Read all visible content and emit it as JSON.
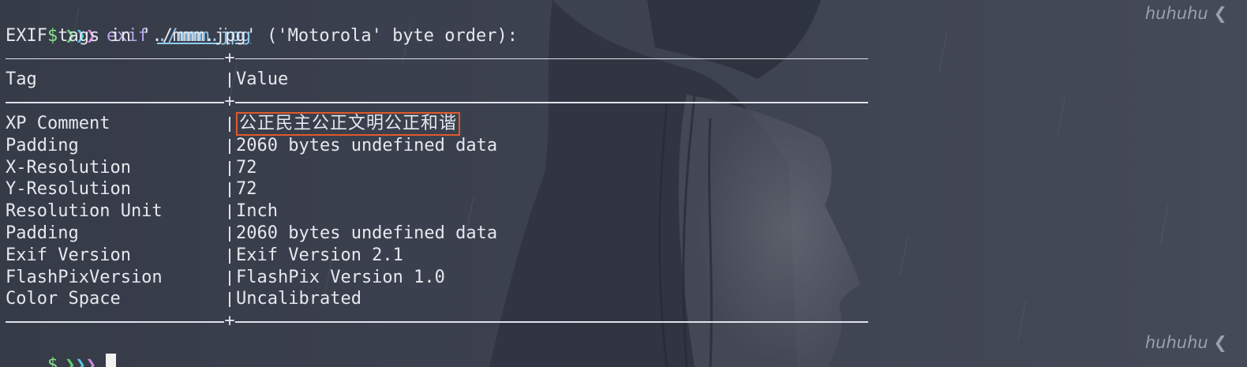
{
  "prompt": {
    "dollar": "$",
    "arrow": "❯",
    "command": "exif",
    "argument": "./mmm.jpg",
    "right_label": "huhuhu ❮"
  },
  "output": {
    "header_line": "EXIF tags in './mmm.jpg' ('Motorola' byte order):",
    "columns": [
      "Tag",
      "Value"
    ],
    "rows": [
      {
        "tag": "XP Comment",
        "value": "公正民主公正文明公正和谐",
        "highlighted": true
      },
      {
        "tag": "Padding",
        "value": "2060 bytes undefined data"
      },
      {
        "tag": "X-Resolution",
        "value": "72"
      },
      {
        "tag": "Y-Resolution",
        "value": "72"
      },
      {
        "tag": "Resolution Unit",
        "value": "Inch"
      },
      {
        "tag": "Padding",
        "value": "2060 bytes undefined data"
      },
      {
        "tag": "Exif Version",
        "value": "Exif Version 2.1"
      },
      {
        "tag": "FlashPixVersion",
        "value": "FlashPix Version 1.0"
      },
      {
        "tag": "Color Space",
        "value": "Uncalibrated"
      }
    ],
    "separator_glyph": "+"
  },
  "colors": {
    "background": "#3a3f4d",
    "text": "#e6e8ee",
    "highlight_box": "#e05a2a",
    "command": "#b8a6e8",
    "argument": "#8ecbf2",
    "dollar": "#8be08b"
  }
}
